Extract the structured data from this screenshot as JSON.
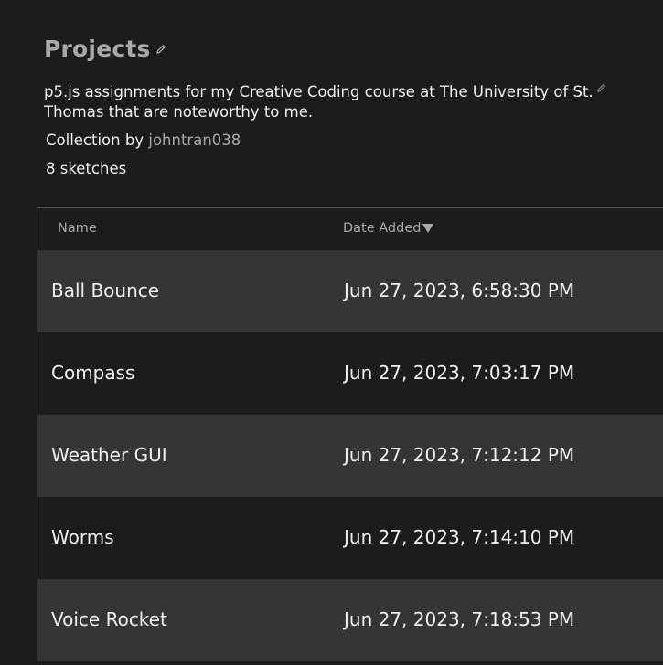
{
  "collection": {
    "title": "Projects",
    "description": "p5.js assignments for my Creative Coding course at The University of St. Thomas that are noteworthy to me.",
    "owner_prefix": "Collection by",
    "owner": "johntran038",
    "sketch_count": "8 sketches"
  },
  "table": {
    "columns": {
      "name": "Name",
      "date_added": "Date Added"
    },
    "sort": {
      "column": "date_added",
      "direction": "descending"
    },
    "rows": [
      {
        "name": "Ball Bounce",
        "date": "Jun 27, 2023, 6:58:30 PM"
      },
      {
        "name": "Compass",
        "date": "Jun 27, 2023, 7:03:17 PM"
      },
      {
        "name": "Weather GUI",
        "date": "Jun 27, 2023, 7:12:12 PM"
      },
      {
        "name": "Worms",
        "date": "Jun 27, 2023, 7:14:10 PM"
      },
      {
        "name": "Voice Rocket",
        "date": "Jun 27, 2023, 7:18:53 PM"
      }
    ]
  },
  "colors": {
    "background": "#1c1c1c",
    "row_alt": "#353535",
    "muted_text": "#a9a9a9",
    "text": "#f0f0f0"
  }
}
